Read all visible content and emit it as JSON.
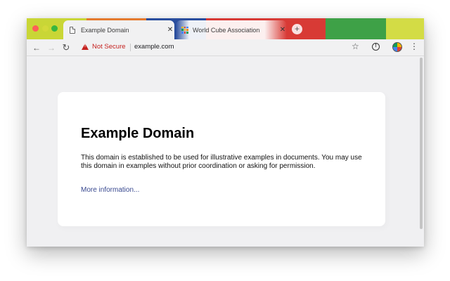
{
  "colors": {
    "stripes": [
      "#c9d636",
      "#e57a2e",
      "#2a4e9e",
      "#d83a35",
      "#3ea147",
      "#d3dc45"
    ],
    "traffic_close": "#ff5f57",
    "traffic_min": "#38b63f",
    "not_secure": "#c5221f",
    "link": "#38488f"
  },
  "tabs": [
    {
      "title": "Example Domain",
      "icon": "document-icon",
      "active": true
    },
    {
      "title": "World Cube Association",
      "icon": "rubiks-cube-icon",
      "active": false
    }
  ],
  "toolbar": {
    "security_label": "Not Secure",
    "url": "example.com",
    "back_icon": "arrow-left-icon",
    "forward_icon": "arrow-right-icon",
    "reload_icon": "reload-icon",
    "bookmark_icon": "star-icon",
    "extension_icon": "info-circle-icon",
    "profile_icon": "avatar-icon",
    "menu_icon": "kebab-menu-icon"
  },
  "page": {
    "heading": "Example Domain",
    "description": "This domain is established to be used for illustrative examples in documents. You may use this domain in examples without prior coordination or asking for permission.",
    "link_text": "More information..."
  }
}
